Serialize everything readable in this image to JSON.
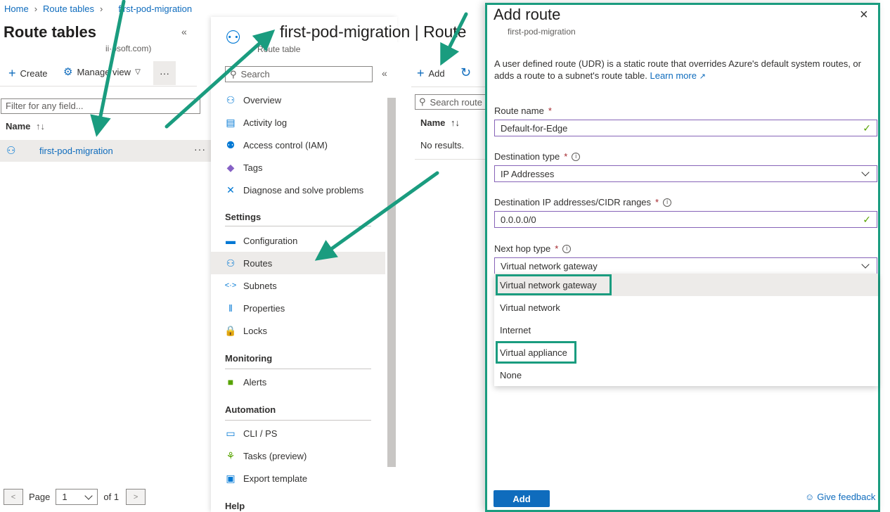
{
  "breadcrumb": {
    "home": "Home",
    "route_tables": "Route tables",
    "current": "first-pod-migration"
  },
  "left": {
    "title": "Route tables",
    "tenant": "ii·osoft.com)",
    "create_label": "Create",
    "manage_view_label": "Manage view",
    "more": "···",
    "filter_placeholder": "Filter for any field...",
    "col_name": "Name",
    "rows": [
      {
        "name": "first-pod-migration"
      }
    ],
    "pager": {
      "page_label": "Page",
      "page_value": "1",
      "of_label": "of 1"
    }
  },
  "resource": {
    "title": "first-pod-migration",
    "title_suffix": "| Route",
    "subtitle": "Route table"
  },
  "nav": {
    "search_placeholder": "Search",
    "items": [
      {
        "label": "Overview",
        "icon": "overview-icon"
      },
      {
        "label": "Activity log",
        "icon": "activity-log-icon"
      },
      {
        "label": "Access control (IAM)",
        "icon": "iam-icon"
      },
      {
        "label": "Tags",
        "icon": "tag-icon"
      },
      {
        "label": "Diagnose and solve problems",
        "icon": "diagnose-icon"
      }
    ],
    "settings_heading": "Settings",
    "settings_items": [
      {
        "label": "Configuration"
      },
      {
        "label": "Routes"
      },
      {
        "label": "Subnets"
      },
      {
        "label": "Properties"
      },
      {
        "label": "Locks"
      }
    ],
    "monitoring_heading": "Monitoring",
    "monitoring_items": [
      {
        "label": "Alerts"
      }
    ],
    "automation_heading": "Automation",
    "automation_items": [
      {
        "label": "CLI / PS"
      },
      {
        "label": "Tasks (preview)"
      },
      {
        "label": "Export template"
      }
    ],
    "help_heading": "Help"
  },
  "routes": {
    "add_label": "Add",
    "search_placeholder": "Search route",
    "col_name": "Name",
    "empty": "No results."
  },
  "panel": {
    "title": "Add route",
    "subtitle": "first-pod-migration",
    "description": "A user defined route (UDR) is a static route that overrides Azure's default system routes, or adds a route to a subnet's route table.",
    "learn_more": "Learn more",
    "route_name_label": "Route name",
    "route_name_value": "Default-for-Edge",
    "dest_type_label": "Destination type",
    "dest_type_value": "IP Addresses",
    "dest_ip_label": "Destination IP addresses/CIDR ranges",
    "dest_ip_value": "0.0.0.0/0",
    "next_hop_label": "Next hop type",
    "next_hop_value": "Virtual network gateway",
    "options": [
      "Virtual network gateway",
      "Virtual network",
      "Internet",
      "Virtual appliance",
      "None"
    ],
    "add_button": "Add",
    "feedback": "Give feedback"
  },
  "colors": {
    "accent": "#0f6cbd",
    "annotation": "#1a9c7f",
    "focus": "#8764b8",
    "valid": "#57a300"
  }
}
